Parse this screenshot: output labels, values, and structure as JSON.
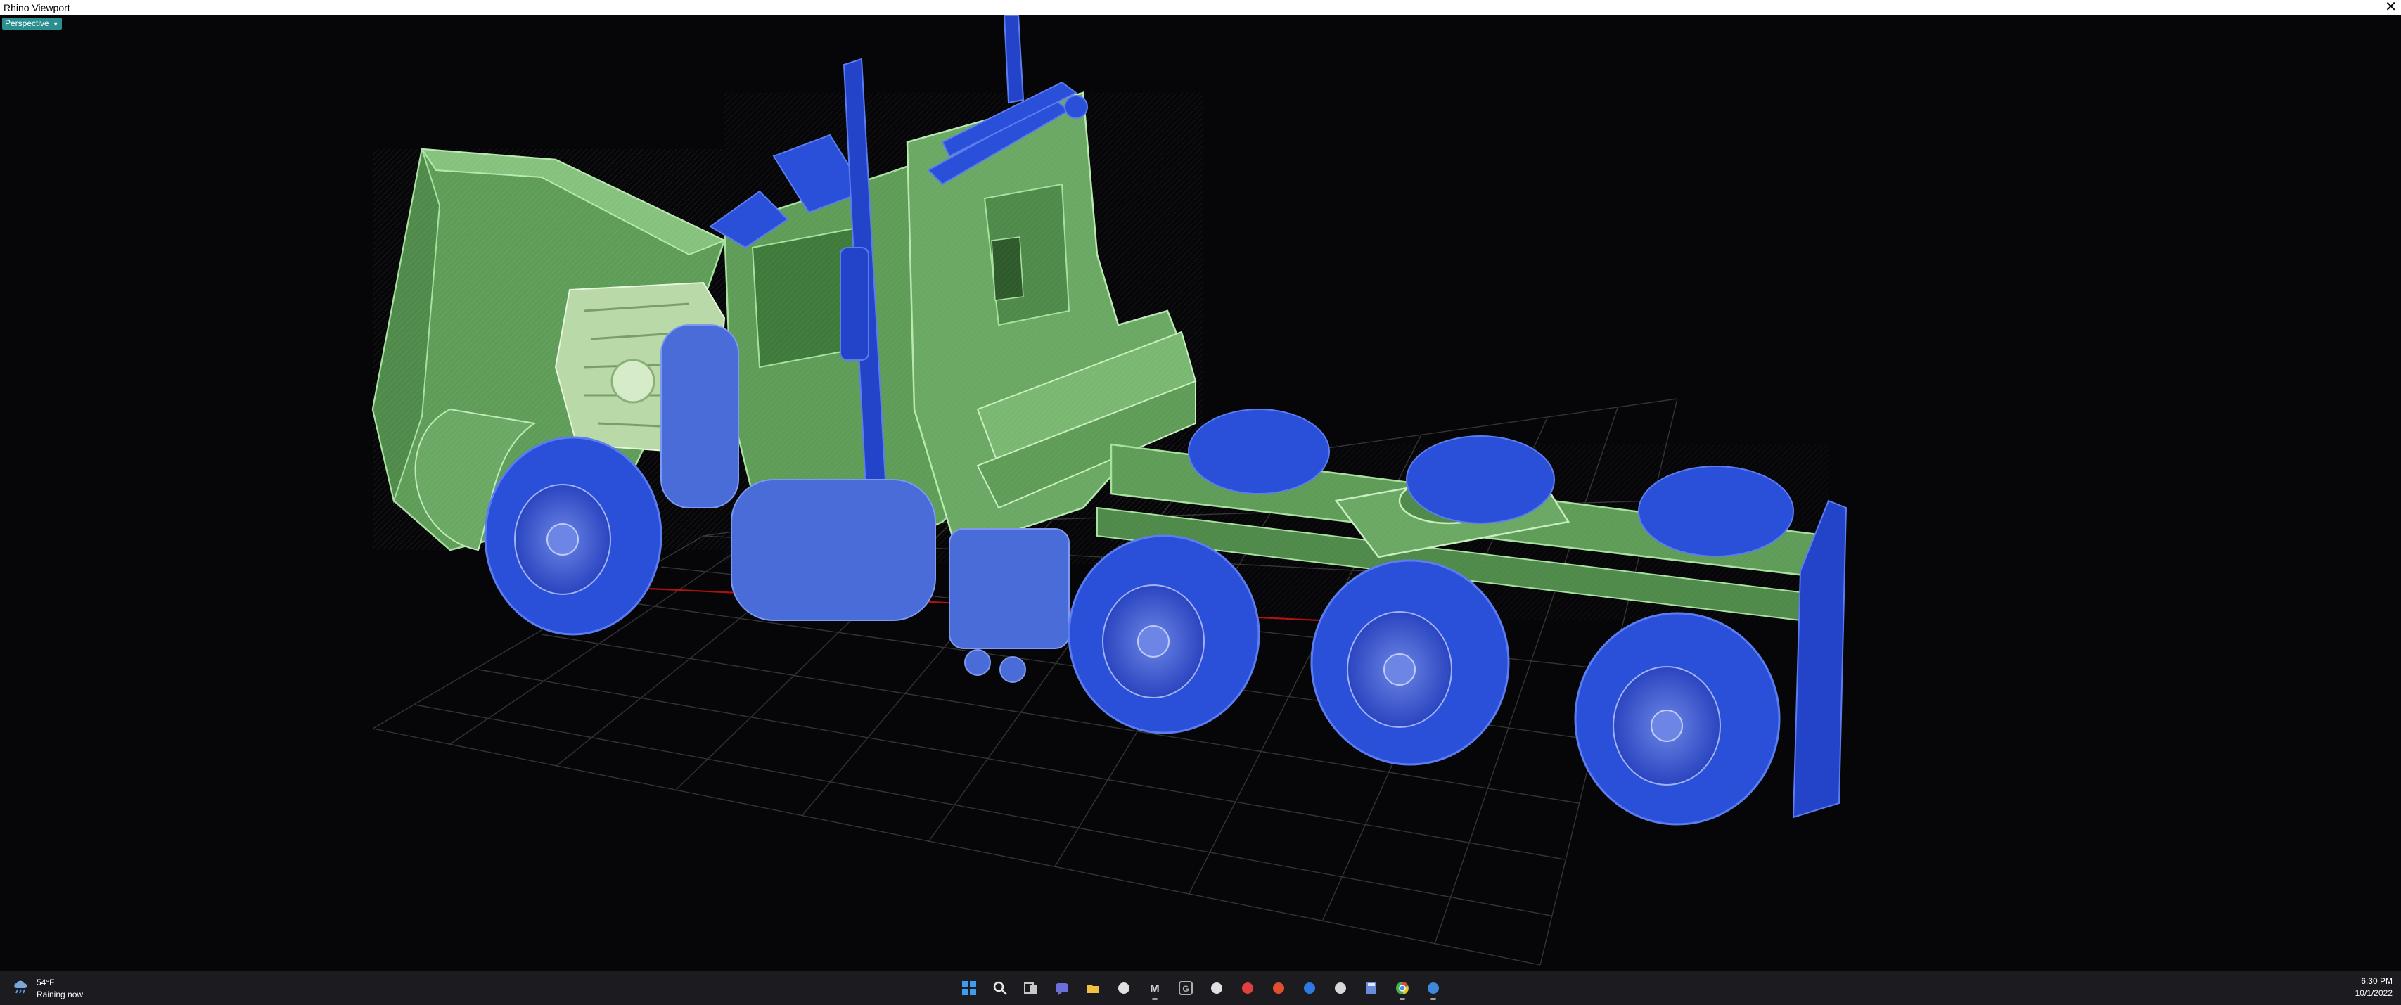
{
  "window": {
    "title": "Rhino Viewport",
    "close_glyph": "✕"
  },
  "viewport": {
    "tab_label": "Perspective",
    "tab_caret": "▼"
  },
  "scene": {
    "description_icon": "truck-3d-model-icon",
    "colors": {
      "body": "#6fae6a",
      "body_edge": "#9fd89a",
      "wheels": "#2a4fd8",
      "wheels_edge": "#5c7df0",
      "grid": "#3a3a3a",
      "axis_x": "#b01010"
    }
  },
  "taskbar": {
    "weather": {
      "temp": "54°F",
      "condition": "Raining now",
      "icon": "rain-cloud-icon"
    },
    "icons": [
      {
        "name": "start-icon",
        "color": "#3b9cf0"
      },
      {
        "name": "search-icon",
        "color": "#e8e8e8"
      },
      {
        "name": "task-view-icon",
        "color": "#c8c8c8"
      },
      {
        "name": "chat-icon",
        "color": "#6a6fdc"
      },
      {
        "name": "file-explorer-icon",
        "color": "#f0c040"
      },
      {
        "name": "alien-app-icon",
        "color": "#e0e0e0"
      },
      {
        "name": "m-app-icon",
        "color": "#d0d0d0"
      },
      {
        "name": "g-app-icon",
        "color": "#b0b0b0"
      },
      {
        "name": "gecko-app-icon",
        "color": "#e0e0e0"
      },
      {
        "name": "red-app-icon",
        "color": "#e04040"
      },
      {
        "name": "puzzle-app-icon",
        "color": "#e05030"
      },
      {
        "name": "blue-app-icon",
        "color": "#2d7be0"
      },
      {
        "name": "grasshopper-app-icon",
        "color": "#d8d8d8"
      },
      {
        "name": "calculator-icon",
        "color": "#6a8cd8"
      },
      {
        "name": "chrome-icon",
        "color": "#4caf50"
      },
      {
        "name": "rhino-icon",
        "color": "#3c8ad8"
      }
    ],
    "active_icons": [
      "m-app-icon",
      "chrome-icon",
      "rhino-icon"
    ],
    "clock": {
      "time": "6:30 PM",
      "date": "10/1/2022"
    }
  }
}
